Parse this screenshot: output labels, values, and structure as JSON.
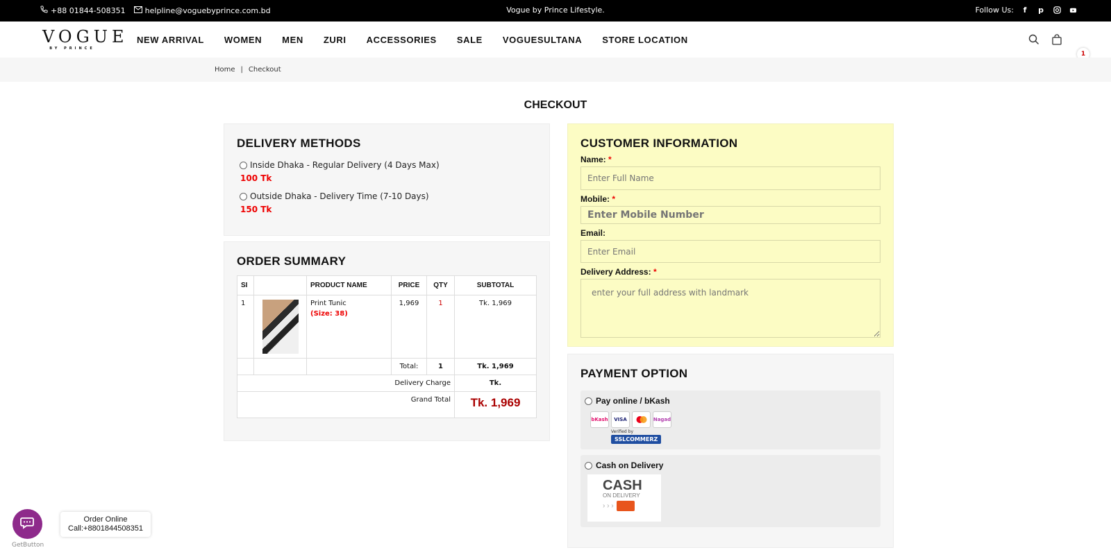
{
  "topbar": {
    "phone": "+88 01844-508351",
    "email": "helpline@voguebyprince.com.bd",
    "tagline": "Vogue by Prince Lifestyle.",
    "follow_label": "Follow Us:",
    "social_icons": [
      "facebook-icon",
      "pinterest-icon",
      "instagram-icon",
      "youtube-icon"
    ]
  },
  "header": {
    "logo_main": "VOGUE",
    "logo_sub": "BY PRINCE",
    "nav": [
      "NEW ARRIVAL",
      "WOMEN",
      "MEN",
      "ZURI",
      "ACCESSORIES",
      "SALE",
      "VOGUESULTANA",
      "STORE LOCATION"
    ],
    "cart_count": "1"
  },
  "breadcrumb": {
    "home": "Home",
    "sep": "|",
    "current": "Checkout"
  },
  "page_title": "CHECKOUT",
  "delivery": {
    "title": "DELIVERY METHODS",
    "options": [
      {
        "label": "Inside Dhaka - Regular Delivery (4 Days Max)",
        "price": "100 Tk"
      },
      {
        "label": "Outside Dhaka - Delivery Time (7-10 Days)",
        "price": "150 Tk"
      }
    ]
  },
  "summary": {
    "title": "ORDER SUMMARY",
    "headers": {
      "sl": "SI",
      "img": "",
      "name": "PRODUCT NAME",
      "price": "PRICE",
      "qty": "QTY",
      "subtotal": "SUBTOTAL"
    },
    "rows": [
      {
        "sl": "1",
        "name": "Print Tunic",
        "size": "(Size: 38)",
        "price": "1,969",
        "qty": "1",
        "subtotal": "Tk. 1,969"
      }
    ],
    "total_label": "Total:",
    "total_qty": "1",
    "total_amount": "Tk. 1,969",
    "delivery_label": "Delivery Charge",
    "delivery_amount": "Tk.",
    "grand_label": "Grand Total",
    "grand_amount": "Tk. 1,969"
  },
  "customer": {
    "title": "CUSTOMER INFORMATION",
    "name_label": "Name:",
    "name_placeholder": "Enter Full Name",
    "mobile_label": "Mobile:",
    "mobile_placeholder": "Enter Mobile Number",
    "email_label": "Email:",
    "email_placeholder": "Enter Email",
    "address_label": "Delivery Address:",
    "address_placeholder": "enter your full address with landmark",
    "required_mark": "*"
  },
  "payment": {
    "title": "PAYMENT OPTION",
    "online_label": "Pay online / bKash",
    "card_logos": [
      "bKash",
      "VISA",
      "MC",
      "Nagad"
    ],
    "verified_by": "Verified by",
    "ssl_logo": "SSLCOMMERZ",
    "cod_label": "Cash on Delivery",
    "cod_big": "CASH",
    "cod_small": "ON DELIVERY",
    "cod_arrows": "› › ›"
  },
  "chat": {
    "tip_line1": "Order Online",
    "tip_line2": "Call:+8801844508351",
    "label": "GetButton"
  },
  "colors": {
    "accent_red": "#e00000",
    "panel_yellow": "#fcfcc4",
    "chat_purple": "#8e2a8b"
  }
}
